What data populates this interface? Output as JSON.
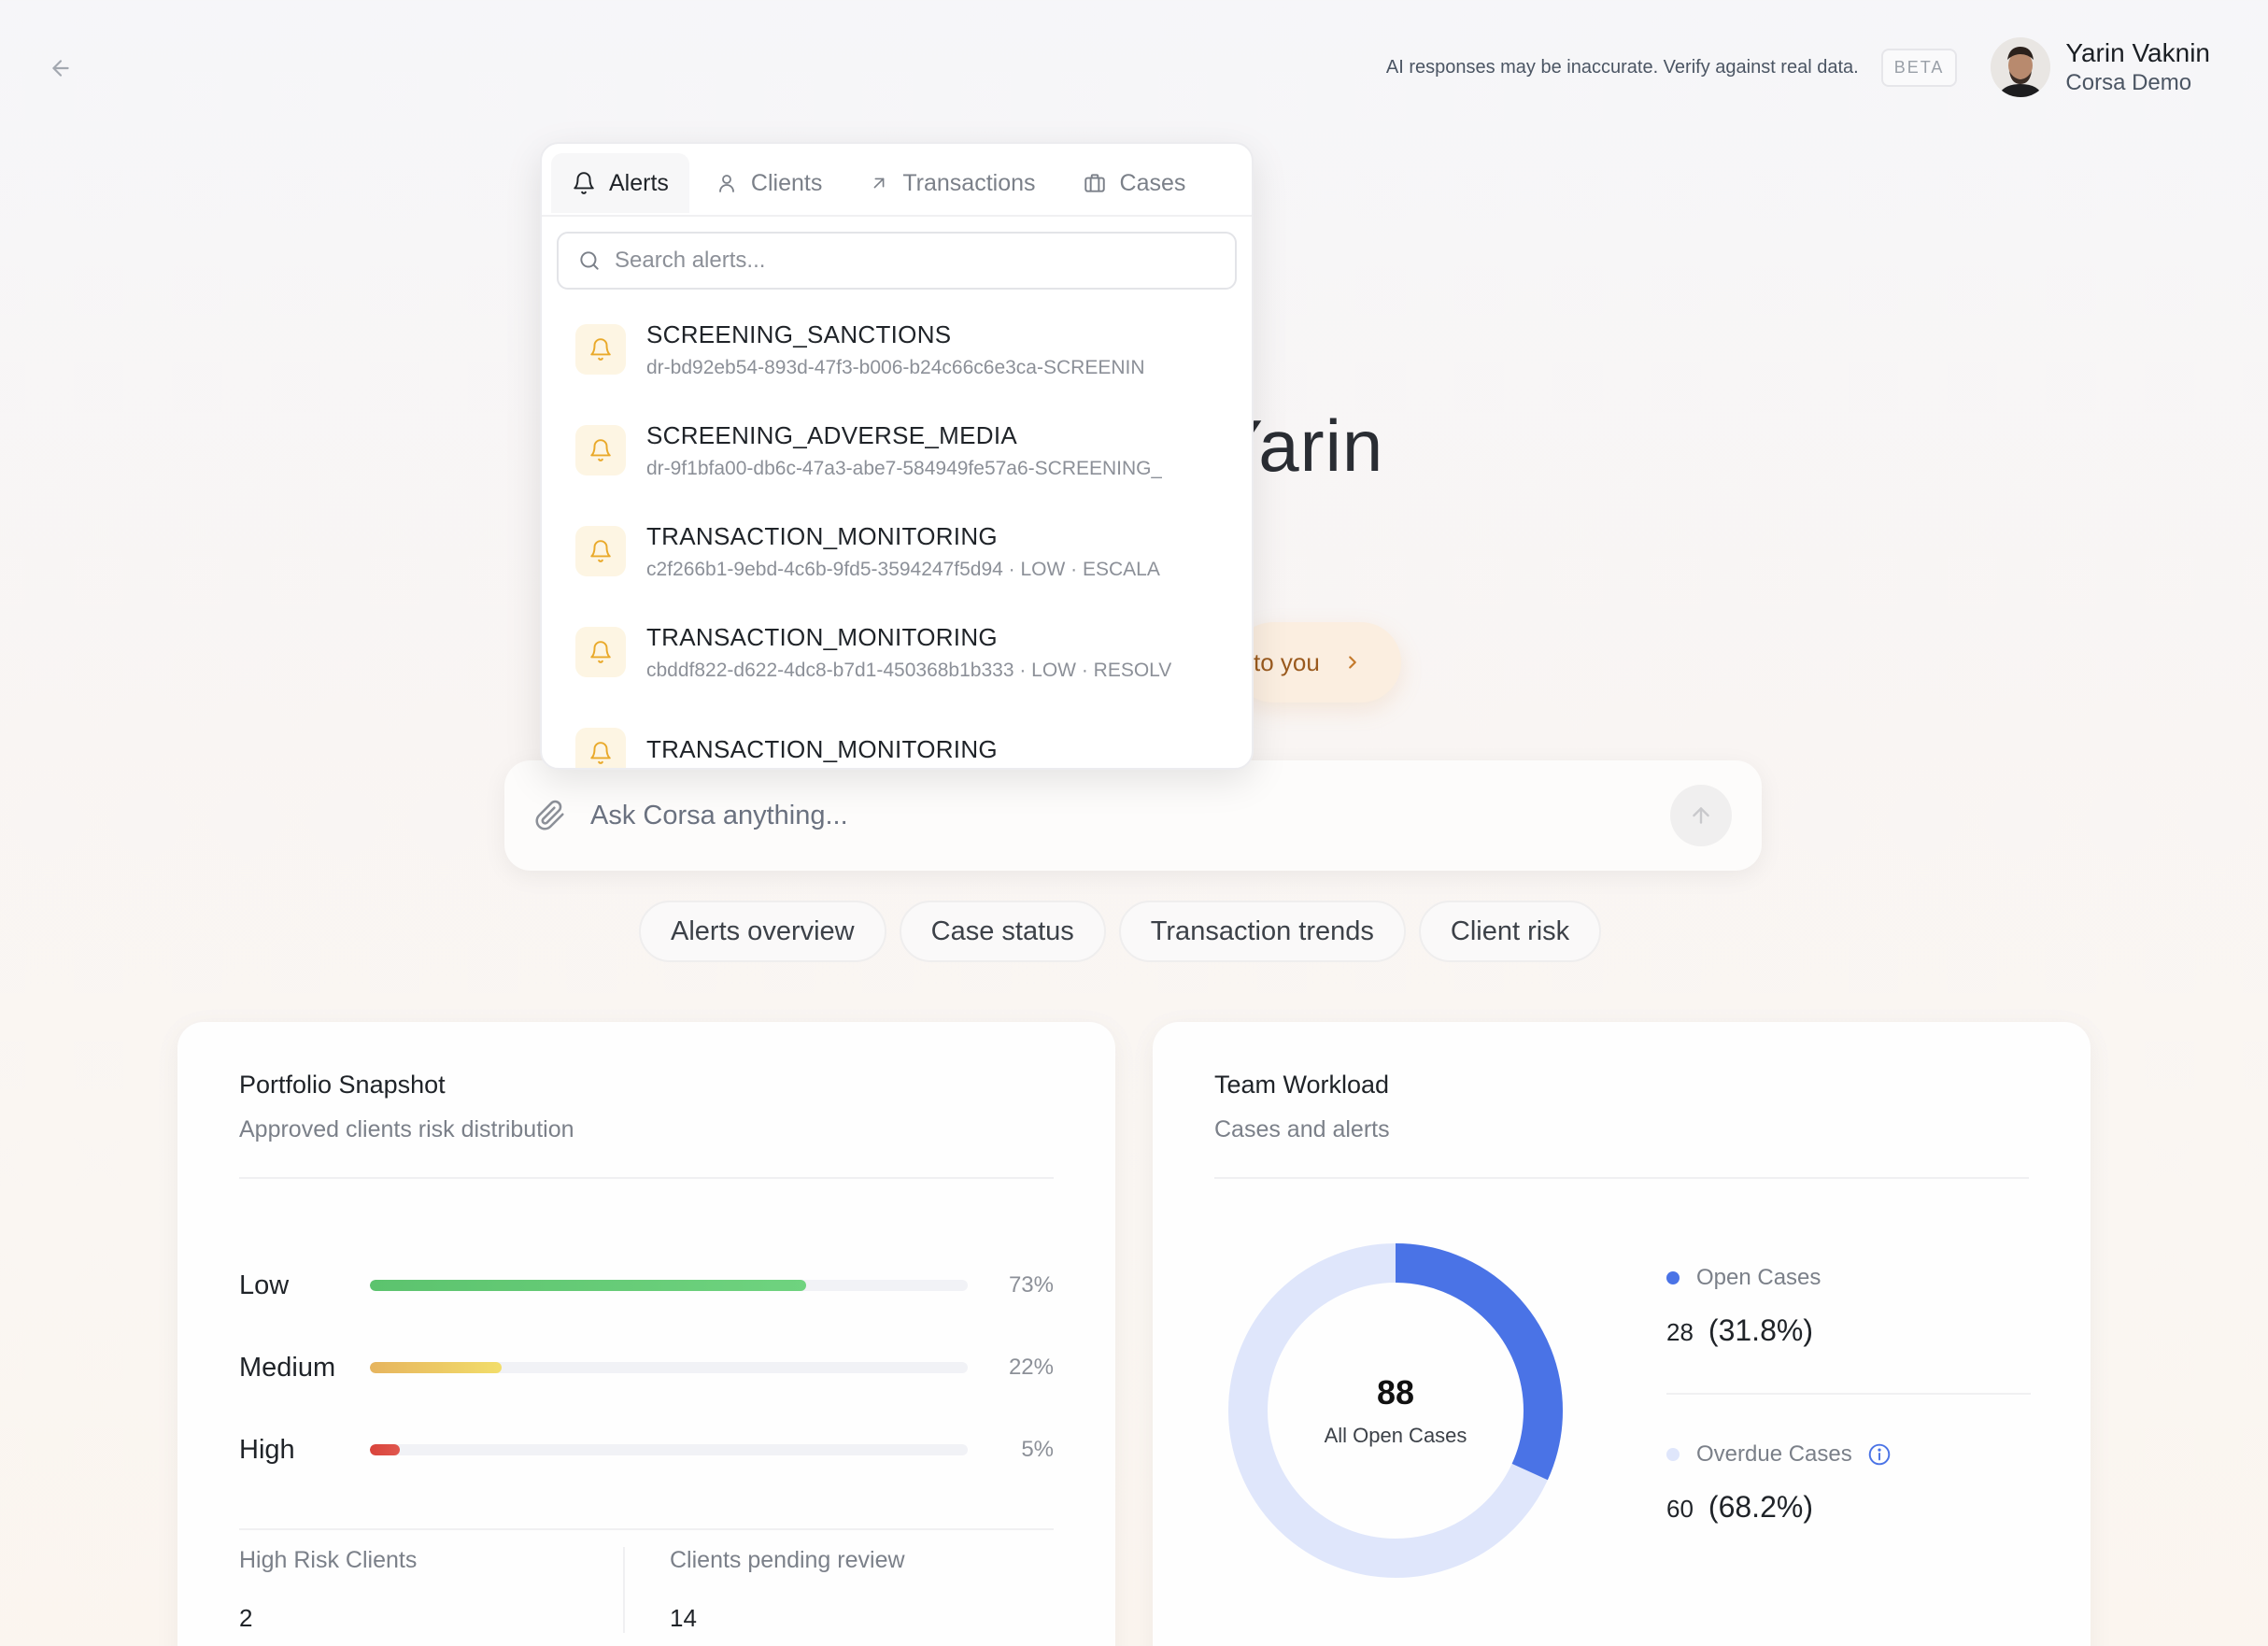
{
  "header": {
    "disclaimer": "AI responses may be inaccurate. Verify against real data.",
    "beta_badge": "BETA",
    "user": {
      "name": "Yarin Vaknin",
      "org": "Corsa Demo"
    }
  },
  "hero": {
    "greeting_visible": "Yarin",
    "suggestion_visible": "to you"
  },
  "ask_bar": {
    "placeholder": "Ask Corsa anything..."
  },
  "quick_actions": [
    "Alerts overview",
    "Case status",
    "Transaction trends",
    "Client risk"
  ],
  "popover": {
    "tabs": [
      {
        "label": "Alerts",
        "icon": "bell-icon",
        "active": true
      },
      {
        "label": "Clients",
        "icon": "user-icon",
        "active": false
      },
      {
        "label": "Transactions",
        "icon": "arrow-up-right-icon",
        "active": false
      },
      {
        "label": "Cases",
        "icon": "briefcase-icon",
        "active": false
      }
    ],
    "search_placeholder": "Search alerts...",
    "alerts": [
      {
        "title": "SCREENING_SANCTIONS",
        "subtitle": "dr-bd92eb54-893d-47f3-b006-b24c66c6e3ca-SCREENIN"
      },
      {
        "title": "SCREENING_ADVERSE_MEDIA",
        "subtitle": "dr-9f1bfa00-db6c-47a3-abe7-584949fe57a6-SCREENING_"
      },
      {
        "title": "TRANSACTION_MONITORING",
        "subtitle": "c2f266b1-9ebd-4c6b-9fd5-3594247f5d94 · LOW · ESCALA"
      },
      {
        "title": "TRANSACTION_MONITORING",
        "subtitle": "cbddf822-d622-4dc8-b7d1-450368b1b333 · LOW · RESOLV"
      },
      {
        "title": "TRANSACTION_MONITORING",
        "subtitle": ""
      }
    ]
  },
  "portfolio": {
    "title": "Portfolio Snapshot",
    "subtitle": "Approved clients risk distribution",
    "risks": [
      {
        "label": "Low",
        "percent": 73,
        "pct_label": "73%",
        "color_from": "#5cc36e",
        "color_to": "#6fd37f"
      },
      {
        "label": "Medium",
        "percent": 22,
        "pct_label": "22%",
        "color_from": "#e6b45e",
        "color_to": "#f2dd6a"
      },
      {
        "label": "High",
        "percent": 5,
        "pct_label": "5%",
        "color_from": "#d9433b",
        "color_to": "#e0574e"
      }
    ],
    "stats": [
      {
        "label": "High Risk Clients",
        "value": "2"
      },
      {
        "label": "Clients pending review",
        "value": "14"
      }
    ]
  },
  "workload": {
    "title": "Team Workload",
    "subtitle": "Cases and alerts",
    "total": "88",
    "total_label": "All Open Cases",
    "open": {
      "label": "Open Cases",
      "count": "28",
      "pct": "(31.8%)",
      "fraction": 0.318,
      "color": "#4a73e6"
    },
    "overdue": {
      "label": "Overdue Cases",
      "count": "60",
      "pct": "(68.2%)",
      "fraction": 0.682,
      "color": "#dfe6fb"
    }
  }
}
